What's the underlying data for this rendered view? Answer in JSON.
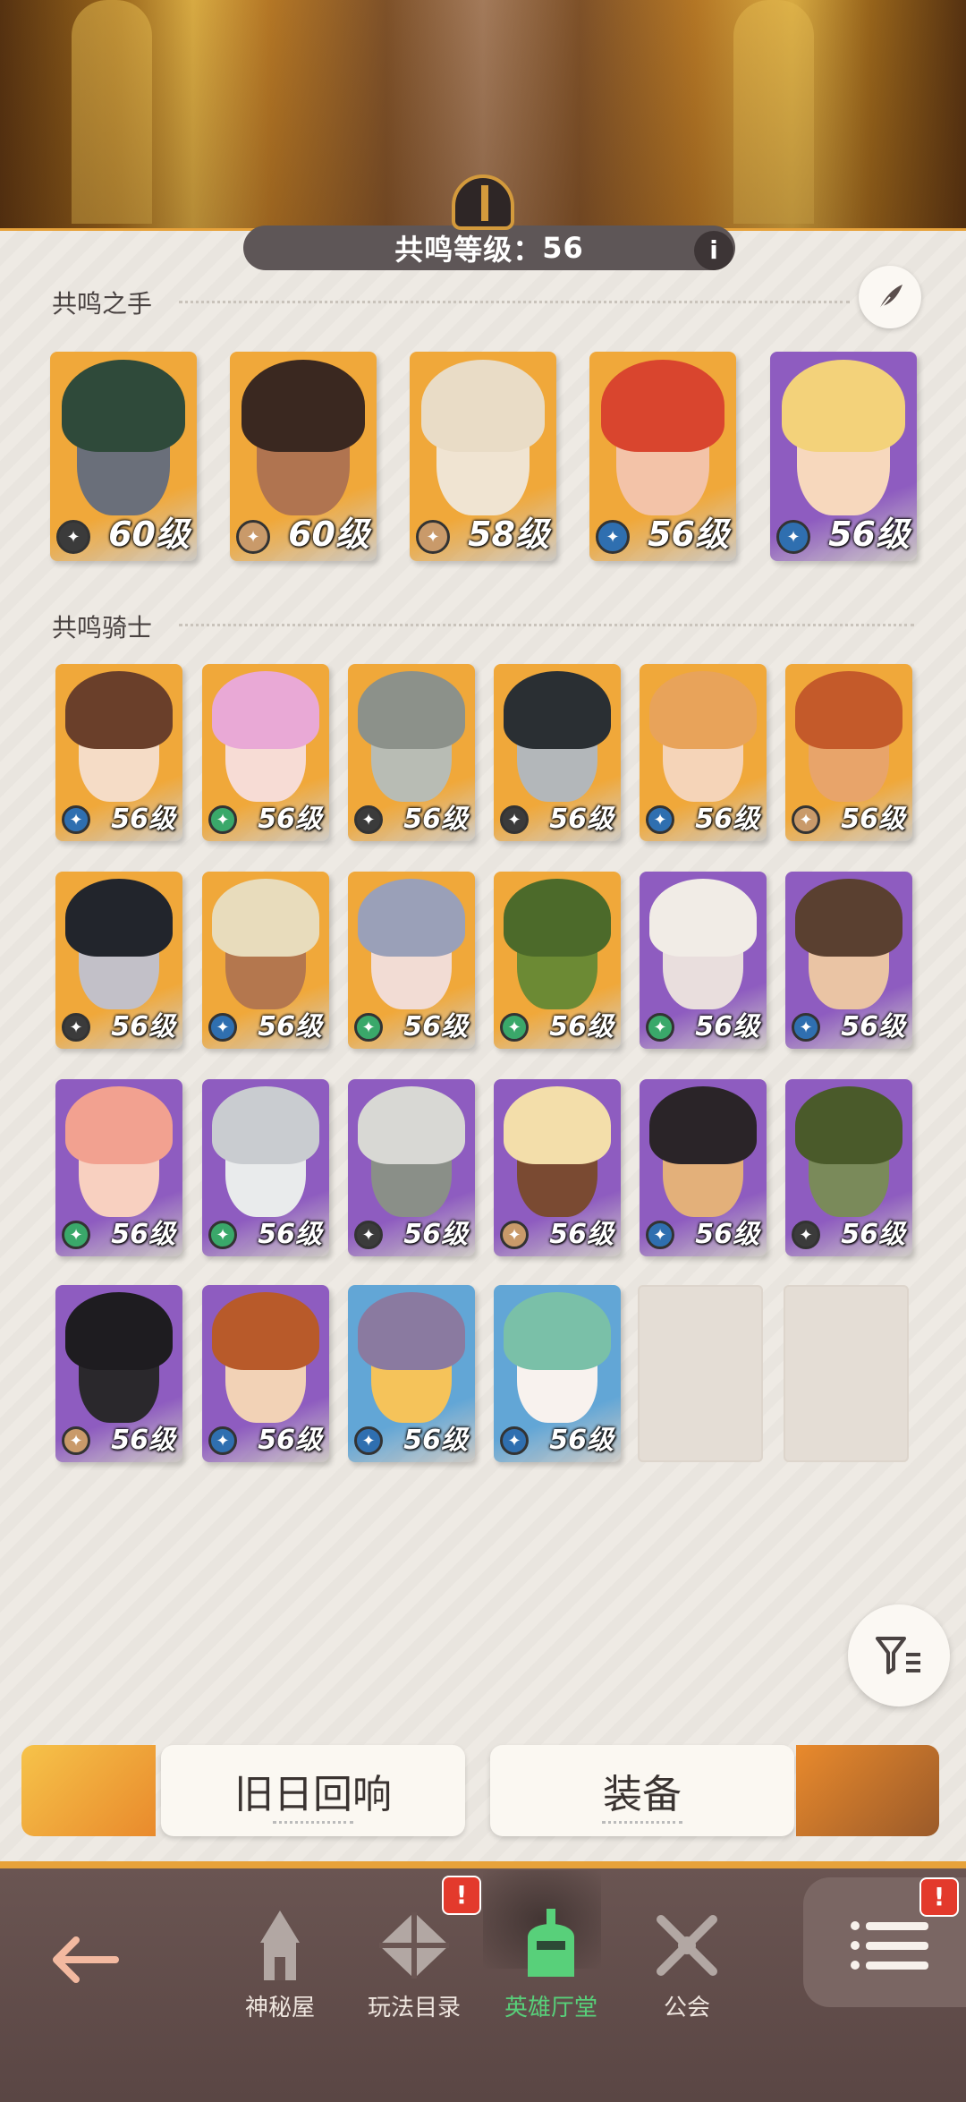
{
  "header": {
    "resonance_label": "共鸣等级：",
    "resonance_level": "56",
    "info_glyph": "i"
  },
  "sections": {
    "hands_title": "共鸣之手",
    "knights_title": "共鸣骑士"
  },
  "hands": [
    {
      "level": "60级",
      "bg": "#f0a83a",
      "accent": "#2f4a3a",
      "skin": "#6a6f7a",
      "elem": "#3b3b3b"
    },
    {
      "level": "60级",
      "bg": "#f0a83a",
      "accent": "#3a2820",
      "skin": "#b07450",
      "elem": "#c99a6a"
    },
    {
      "level": "58级",
      "bg": "#f0a83a",
      "accent": "#e9dcc6",
      "skin": "#f0e4d2",
      "elem": "#c99a6a"
    },
    {
      "level": "56级",
      "bg": "#f0a83a",
      "accent": "#d9452e",
      "skin": "#f3c3a8",
      "elem": "#2f6fb0"
    },
    {
      "level": "56级",
      "bg": "#8e5cc0",
      "accent": "#f3d27a",
      "skin": "#f7d8bd",
      "elem": "#2f6fb0"
    }
  ],
  "knights": [
    {
      "level": "56级",
      "bg": "#f0a83a",
      "accent": "#6a3f2a",
      "skin": "#f5dcc6",
      "elem": "#2f6fb0"
    },
    {
      "level": "56级",
      "bg": "#f0a83a",
      "accent": "#e9a9d6",
      "skin": "#f7dcd5",
      "elem": "#3aa86a"
    },
    {
      "level": "56级",
      "bg": "#f0a83a",
      "accent": "#8c918a",
      "skin": "#b8bcb4",
      "elem": "#3b3b3b"
    },
    {
      "level": "56级",
      "bg": "#f0a83a",
      "accent": "#2a2f33",
      "skin": "#b3b7ba",
      "elem": "#3b3b3b"
    },
    {
      "level": "56级",
      "bg": "#f0a83a",
      "accent": "#e8a35a",
      "skin": "#f5d4b8",
      "elem": "#2f6fb0"
    },
    {
      "level": "56级",
      "bg": "#f0a83a",
      "accent": "#c45a2a",
      "skin": "#e8a46a",
      "elem": "#c99a6a"
    },
    {
      "level": "56级",
      "bg": "#f0a83a",
      "accent": "#22252c",
      "skin": "#c2c0c8",
      "elem": "#3b3b3b"
    },
    {
      "level": "56级",
      "bg": "#f0a83a",
      "accent": "#e8dcbc",
      "skin": "#b4774e",
      "elem": "#2f6fb0"
    },
    {
      "level": "56级",
      "bg": "#f0a83a",
      "accent": "#9aa0b8",
      "skin": "#f2dcd4",
      "elem": "#3aa86a"
    },
    {
      "level": "56级",
      "bg": "#f0a83a",
      "accent": "#4c6a2a",
      "skin": "#6c8a34",
      "elem": "#3aa86a"
    },
    {
      "level": "56级",
      "bg": "#8e5cc0",
      "accent": "#f1ece6",
      "skin": "#e9dedd",
      "elem": "#3aa86a"
    },
    {
      "level": "56级",
      "bg": "#8e5cc0",
      "accent": "#5a4030",
      "skin": "#eac4a4",
      "elem": "#2f6fb0"
    },
    {
      "level": "56级",
      "bg": "#8e5cc0",
      "accent": "#f2a190",
      "skin": "#f8d0c0",
      "elem": "#3aa86a"
    },
    {
      "level": "56级",
      "bg": "#8e5cc0",
      "accent": "#c9ccd0",
      "skin": "#e9ebec",
      "elem": "#3aa86a"
    },
    {
      "level": "56级",
      "bg": "#8e5cc0",
      "accent": "#d8d8d4",
      "skin": "#8a8f88",
      "elem": "#3b3b3b"
    },
    {
      "level": "56级",
      "bg": "#8e5cc0",
      "accent": "#f3deaa",
      "skin": "#7a4a32",
      "elem": "#c99a6a"
    },
    {
      "level": "56级",
      "bg": "#8e5cc0",
      "accent": "#2a2428",
      "skin": "#e3b07a",
      "elem": "#2f6fb0"
    },
    {
      "level": "56级",
      "bg": "#8e5cc0",
      "accent": "#4a5a2a",
      "skin": "#7a8a5a",
      "elem": "#3b3b3b"
    },
    {
      "level": "56级",
      "bg": "#8e5cc0",
      "accent": "#1e1c20",
      "skin": "#2a282c",
      "elem": "#c99a6a"
    },
    {
      "level": "56级",
      "bg": "#8e5cc0",
      "accent": "#b85a2a",
      "skin": "#f2d2b6",
      "elem": "#2f6fb0"
    },
    {
      "level": "56级",
      "bg": "#62a6d6",
      "accent": "#8a7aa0",
      "skin": "#f5c35a",
      "elem": "#2f6fb0"
    },
    {
      "level": "56级",
      "bg": "#62a6d6",
      "accent": "#7ac0a8",
      "skin": "#f8f2ee",
      "elem": "#2f6fb0"
    }
  ],
  "buttons": {
    "echo_label": "旧日回响",
    "equip_label": "装备"
  },
  "nav": [
    {
      "label": "神秘屋",
      "icon": "tower-icon",
      "badge": ""
    },
    {
      "label": "玩法目录",
      "icon": "catalog-icon",
      "badge": "!"
    },
    {
      "label": "英雄厅堂",
      "icon": "knight-helmet-icon",
      "badge": ""
    },
    {
      "label": "公会",
      "icon": "crossed-swords-icon",
      "badge": ""
    }
  ],
  "menu_badge": "!",
  "colors": {
    "active_nav": "#58d07a",
    "inactive_nav": "#efe6df",
    "accent": "#e7a23a"
  }
}
